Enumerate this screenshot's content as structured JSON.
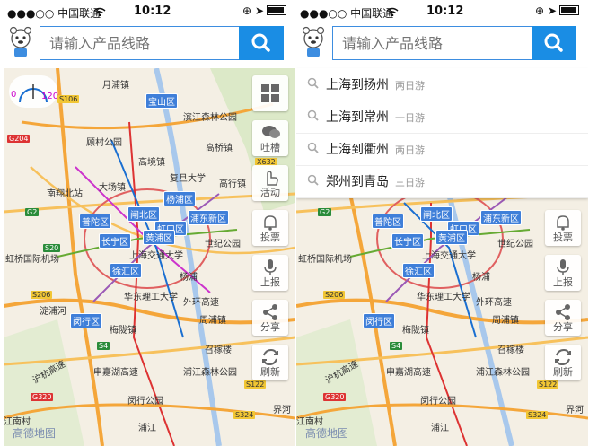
{
  "status_bar": {
    "carrier": "●●●○○ 中国联通",
    "time": "10:12"
  },
  "search": {
    "placeholder": "请输入产品线路"
  },
  "speed": {
    "min": "0",
    "max": "120"
  },
  "side_buttons": {
    "tucao": "吐槽",
    "activity": "活动",
    "vote": "投票",
    "report": "上报",
    "share": "分享",
    "refresh": "刷新"
  },
  "suggestions": [
    {
      "route": "上海到扬州",
      "duration": "两日游"
    },
    {
      "route": "上海到常州",
      "duration": "一日游"
    },
    {
      "route": "上海到衢州",
      "duration": "两日游"
    },
    {
      "route": "郑州到青岛",
      "duration": "三日游"
    }
  ],
  "map": {
    "districts": [
      "宝山区",
      "杨浦区",
      "闸北区",
      "普陀区",
      "虹口区",
      "长宁区",
      "黄浦区",
      "浦东新区",
      "徐汇区",
      "闵行区"
    ],
    "places": [
      "月浦镇",
      "滨江森林公园",
      "顾村公园",
      "高桥镇",
      "高境镇",
      "复旦大学",
      "高行镇",
      "大场镇",
      "南翔北站",
      "世纪公园",
      "虹桥国际机场",
      "上海交通大学",
      "华东理工大学",
      "外环高速",
      "周浦镇",
      "梅陇镇",
      "召稼楼",
      "浦江森林公园",
      "闵行公园",
      "申嘉湖高速",
      "沪杭高速",
      "界河",
      "江南村",
      "杨浦",
      "淀浦河",
      "浦江"
    ],
    "roads": [
      "S106",
      "G204",
      "X632",
      "G2",
      "S206",
      "S4",
      "S122",
      "G320",
      "S324",
      "S20"
    ],
    "watermark": "高德地图"
  }
}
